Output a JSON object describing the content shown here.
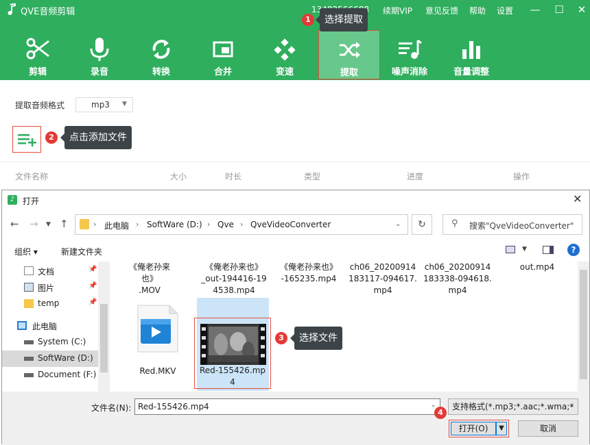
{
  "app": {
    "title": "QVE音频剪辑",
    "phone": "13482566688",
    "vip": "续期VIP",
    "feedback": "意见反馈",
    "help": "帮助",
    "settings": "设置"
  },
  "tools": [
    {
      "label": "剪辑",
      "icon": "scissors-icon"
    },
    {
      "label": "录音",
      "icon": "microphone-icon"
    },
    {
      "label": "转换",
      "icon": "convert-icon"
    },
    {
      "label": "合并",
      "icon": "merge-icon"
    },
    {
      "label": "变速",
      "icon": "speed-icon"
    },
    {
      "label": "提取",
      "icon": "shuffle-icon",
      "selected": true
    },
    {
      "label": "噪声消除",
      "icon": "noise-removal-icon"
    },
    {
      "label": "音量调整",
      "icon": "volume-bars-icon"
    }
  ],
  "steps": {
    "step1": {
      "num": "1",
      "text": "选择提取"
    },
    "step2": {
      "num": "2",
      "text": "点击添加文件"
    },
    "step3": {
      "num": "3",
      "text": "选择文件"
    },
    "step4": {
      "num": "4"
    }
  },
  "format": {
    "label": "提取音频格式",
    "value": "mp3"
  },
  "table": {
    "headers": [
      "文件名称",
      "大小",
      "时长",
      "类型",
      "进度",
      "操作"
    ]
  },
  "dialog": {
    "title": "打开",
    "breadcrumb": [
      "此电脑",
      "SoftWare (D:)",
      "Qve",
      "QveVideoConverter"
    ],
    "search_placeholder": "搜索\"QveVideoConverter\"",
    "organize": "组织 ▾",
    "new_folder": "新建文件夹",
    "sidebar": [
      {
        "label": "文档",
        "icon": "document-icon"
      },
      {
        "label": "图片",
        "icon": "picture-icon"
      },
      {
        "label": "temp",
        "icon": "folder-icon"
      },
      {
        "label": "此电脑",
        "icon": "computer-icon"
      },
      {
        "label": "System (C:)",
        "icon": "drive-icon"
      },
      {
        "label": "SoftWare (D:)",
        "icon": "drive-icon",
        "selected": true
      },
      {
        "label": "Document (F:)",
        "icon": "drive-icon"
      }
    ],
    "files_row1": [
      [
        "《俺老孙来也》",
        ".MOV"
      ],
      [
        "《俺老孙来也》",
        "_out-194416-19",
        "4538.mp4"
      ],
      [
        "《俺老孙来也》",
        "-165235.mp4"
      ],
      [
        "ch06_20200914",
        "183117-094617.",
        "mp4"
      ],
      [
        "ch06_20200914",
        "183338-094618.",
        "mp4"
      ],
      [
        "out.mp4"
      ]
    ],
    "files_row2": [
      [
        "Red.MKV"
      ],
      [
        "Red-155426.mp",
        "4"
      ]
    ],
    "filename_label": "文件名(N):",
    "filename_value": "Red-155426.mp4",
    "type_filter": "支持格式(*.mp3;*.aac;*.wma;*",
    "open_button": "打开(O)",
    "cancel_button": "取消"
  },
  "colors": {
    "brand_green": "#2fae5e",
    "selected_tool": "#66c88a",
    "highlight_red": "#e74c3c",
    "tooltip_bg": "#3d4448"
  }
}
